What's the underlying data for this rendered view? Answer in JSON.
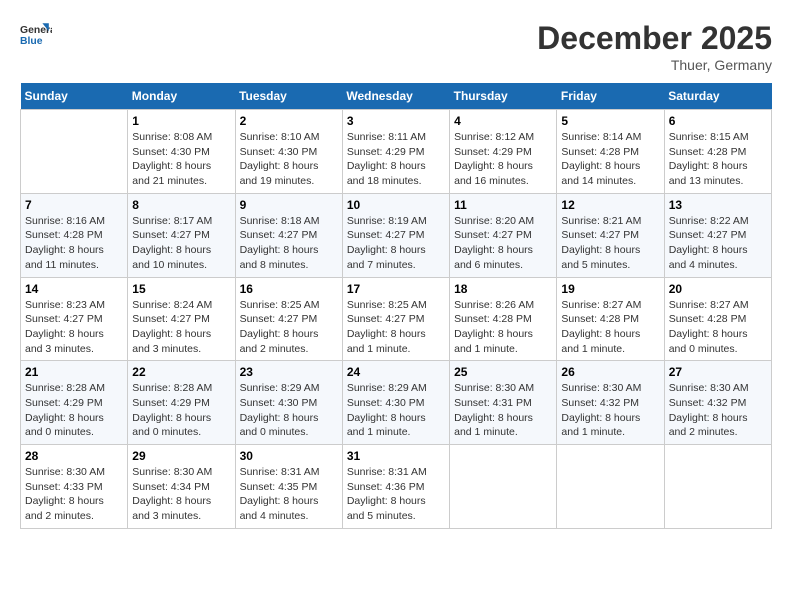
{
  "header": {
    "logo_general": "General",
    "logo_blue": "Blue",
    "month_title": "December 2025",
    "location": "Thuer, Germany"
  },
  "days_of_week": [
    "Sunday",
    "Monday",
    "Tuesday",
    "Wednesday",
    "Thursday",
    "Friday",
    "Saturday"
  ],
  "weeks": [
    [
      {
        "day": "",
        "info": ""
      },
      {
        "day": "1",
        "info": "Sunrise: 8:08 AM\nSunset: 4:30 PM\nDaylight: 8 hours\nand 21 minutes."
      },
      {
        "day": "2",
        "info": "Sunrise: 8:10 AM\nSunset: 4:30 PM\nDaylight: 8 hours\nand 19 minutes."
      },
      {
        "day": "3",
        "info": "Sunrise: 8:11 AM\nSunset: 4:29 PM\nDaylight: 8 hours\nand 18 minutes."
      },
      {
        "day": "4",
        "info": "Sunrise: 8:12 AM\nSunset: 4:29 PM\nDaylight: 8 hours\nand 16 minutes."
      },
      {
        "day": "5",
        "info": "Sunrise: 8:14 AM\nSunset: 4:28 PM\nDaylight: 8 hours\nand 14 minutes."
      },
      {
        "day": "6",
        "info": "Sunrise: 8:15 AM\nSunset: 4:28 PM\nDaylight: 8 hours\nand 13 minutes."
      }
    ],
    [
      {
        "day": "7",
        "info": "Sunrise: 8:16 AM\nSunset: 4:28 PM\nDaylight: 8 hours\nand 11 minutes."
      },
      {
        "day": "8",
        "info": "Sunrise: 8:17 AM\nSunset: 4:27 PM\nDaylight: 8 hours\nand 10 minutes."
      },
      {
        "day": "9",
        "info": "Sunrise: 8:18 AM\nSunset: 4:27 PM\nDaylight: 8 hours\nand 8 minutes."
      },
      {
        "day": "10",
        "info": "Sunrise: 8:19 AM\nSunset: 4:27 PM\nDaylight: 8 hours\nand 7 minutes."
      },
      {
        "day": "11",
        "info": "Sunrise: 8:20 AM\nSunset: 4:27 PM\nDaylight: 8 hours\nand 6 minutes."
      },
      {
        "day": "12",
        "info": "Sunrise: 8:21 AM\nSunset: 4:27 PM\nDaylight: 8 hours\nand 5 minutes."
      },
      {
        "day": "13",
        "info": "Sunrise: 8:22 AM\nSunset: 4:27 PM\nDaylight: 8 hours\nand 4 minutes."
      }
    ],
    [
      {
        "day": "14",
        "info": "Sunrise: 8:23 AM\nSunset: 4:27 PM\nDaylight: 8 hours\nand 3 minutes."
      },
      {
        "day": "15",
        "info": "Sunrise: 8:24 AM\nSunset: 4:27 PM\nDaylight: 8 hours\nand 3 minutes."
      },
      {
        "day": "16",
        "info": "Sunrise: 8:25 AM\nSunset: 4:27 PM\nDaylight: 8 hours\nand 2 minutes."
      },
      {
        "day": "17",
        "info": "Sunrise: 8:25 AM\nSunset: 4:27 PM\nDaylight: 8 hours\nand 1 minute."
      },
      {
        "day": "18",
        "info": "Sunrise: 8:26 AM\nSunset: 4:28 PM\nDaylight: 8 hours\nand 1 minute."
      },
      {
        "day": "19",
        "info": "Sunrise: 8:27 AM\nSunset: 4:28 PM\nDaylight: 8 hours\nand 1 minute."
      },
      {
        "day": "20",
        "info": "Sunrise: 8:27 AM\nSunset: 4:28 PM\nDaylight: 8 hours\nand 0 minutes."
      }
    ],
    [
      {
        "day": "21",
        "info": "Sunrise: 8:28 AM\nSunset: 4:29 PM\nDaylight: 8 hours\nand 0 minutes."
      },
      {
        "day": "22",
        "info": "Sunrise: 8:28 AM\nSunset: 4:29 PM\nDaylight: 8 hours\nand 0 minutes."
      },
      {
        "day": "23",
        "info": "Sunrise: 8:29 AM\nSunset: 4:30 PM\nDaylight: 8 hours\nand 0 minutes."
      },
      {
        "day": "24",
        "info": "Sunrise: 8:29 AM\nSunset: 4:30 PM\nDaylight: 8 hours\nand 1 minute."
      },
      {
        "day": "25",
        "info": "Sunrise: 8:30 AM\nSunset: 4:31 PM\nDaylight: 8 hours\nand 1 minute."
      },
      {
        "day": "26",
        "info": "Sunrise: 8:30 AM\nSunset: 4:32 PM\nDaylight: 8 hours\nand 1 minute."
      },
      {
        "day": "27",
        "info": "Sunrise: 8:30 AM\nSunset: 4:32 PM\nDaylight: 8 hours\nand 2 minutes."
      }
    ],
    [
      {
        "day": "28",
        "info": "Sunrise: 8:30 AM\nSunset: 4:33 PM\nDaylight: 8 hours\nand 2 minutes."
      },
      {
        "day": "29",
        "info": "Sunrise: 8:30 AM\nSunset: 4:34 PM\nDaylight: 8 hours\nand 3 minutes."
      },
      {
        "day": "30",
        "info": "Sunrise: 8:31 AM\nSunset: 4:35 PM\nDaylight: 8 hours\nand 4 minutes."
      },
      {
        "day": "31",
        "info": "Sunrise: 8:31 AM\nSunset: 4:36 PM\nDaylight: 8 hours\nand 5 minutes."
      },
      {
        "day": "",
        "info": ""
      },
      {
        "day": "",
        "info": ""
      },
      {
        "day": "",
        "info": ""
      }
    ]
  ]
}
